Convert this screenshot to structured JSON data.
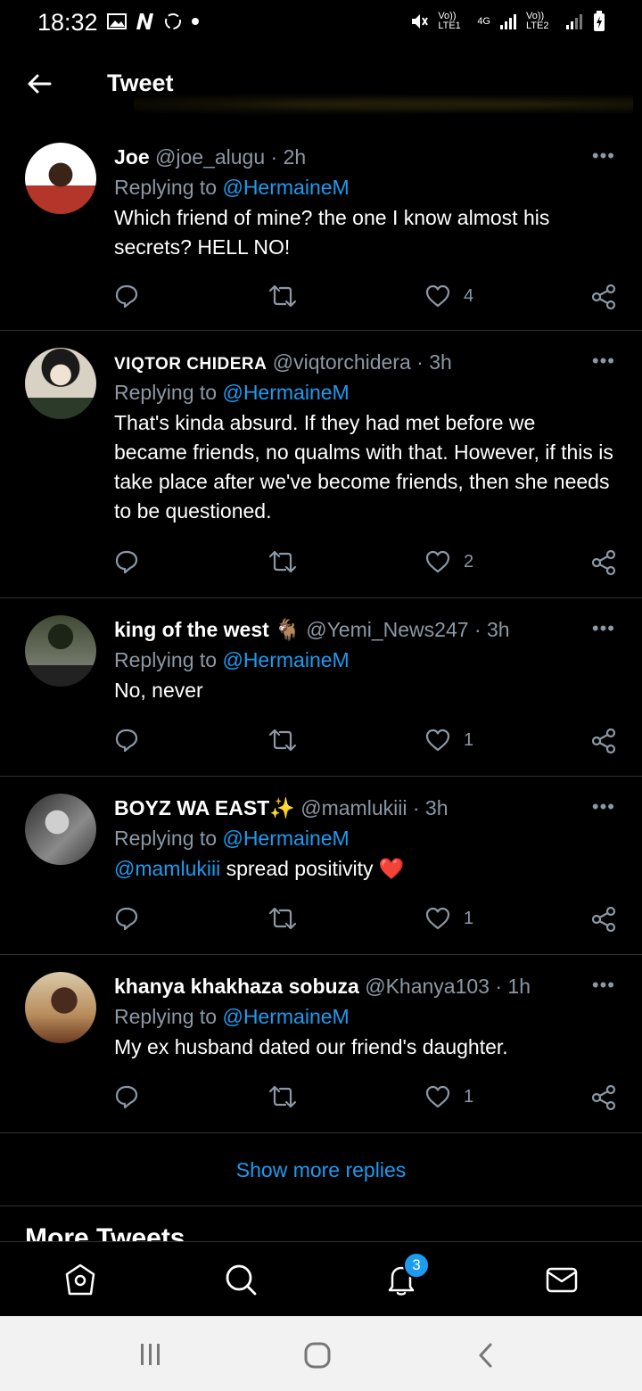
{
  "status_bar": {
    "time": "18:32",
    "sim1": "Vo)) LTE1",
    "net": "4G",
    "sim2": "Vo)) LTE2"
  },
  "header": {
    "title": "Tweet"
  },
  "replies": [
    {
      "name": "Joe",
      "handle": "@joe_alugu",
      "ago": "2h",
      "replying_prefix": "Replying to ",
      "replying_to": "@HermaineM",
      "text": "Which friend of mine? the one I know almost his secrets? HELL NO!",
      "likes": "4"
    },
    {
      "name": "VIQTOR CHIDERA",
      "handle": "@viqtorchidera",
      "ago": "3h",
      "replying_prefix": "Replying to ",
      "replying_to": "@HermaineM",
      "text": "That's kinda absurd. If they had met before we became friends, no qualms with that. However, if this is take place after we've become friends, then she needs to be questioned.",
      "likes": "2"
    },
    {
      "name": "king of the west 🐐",
      "handle": "@Yemi_News247",
      "ago": "3h",
      "replying_prefix": "Replying to ",
      "replying_to": "@HermaineM",
      "text": "No, never",
      "likes": "1"
    },
    {
      "name": "BOYZ WA EAST✨",
      "handle": "@mamlukiii",
      "ago": "3h",
      "replying_prefix": "Replying to ",
      "replying_to": "@HermaineM",
      "text_mention": "@mamlukiii",
      "text": " spread positivity ❤️",
      "likes": "1"
    },
    {
      "name": "khanya khakhaza sobuza",
      "handle": "@Khanya103",
      "ago": "1h",
      "replying_prefix": "Replying to ",
      "replying_to": "@HermaineM",
      "text": "My ex husband dated our friend's daughter.",
      "likes": "1"
    }
  ],
  "show_more": "Show more replies",
  "more_tweets": "More Tweets",
  "bottom_nav": {
    "notifications_badge": "3"
  },
  "colors": {
    "accent": "#1d9bf0",
    "muted": "#8b98a5",
    "background": "#000000"
  }
}
